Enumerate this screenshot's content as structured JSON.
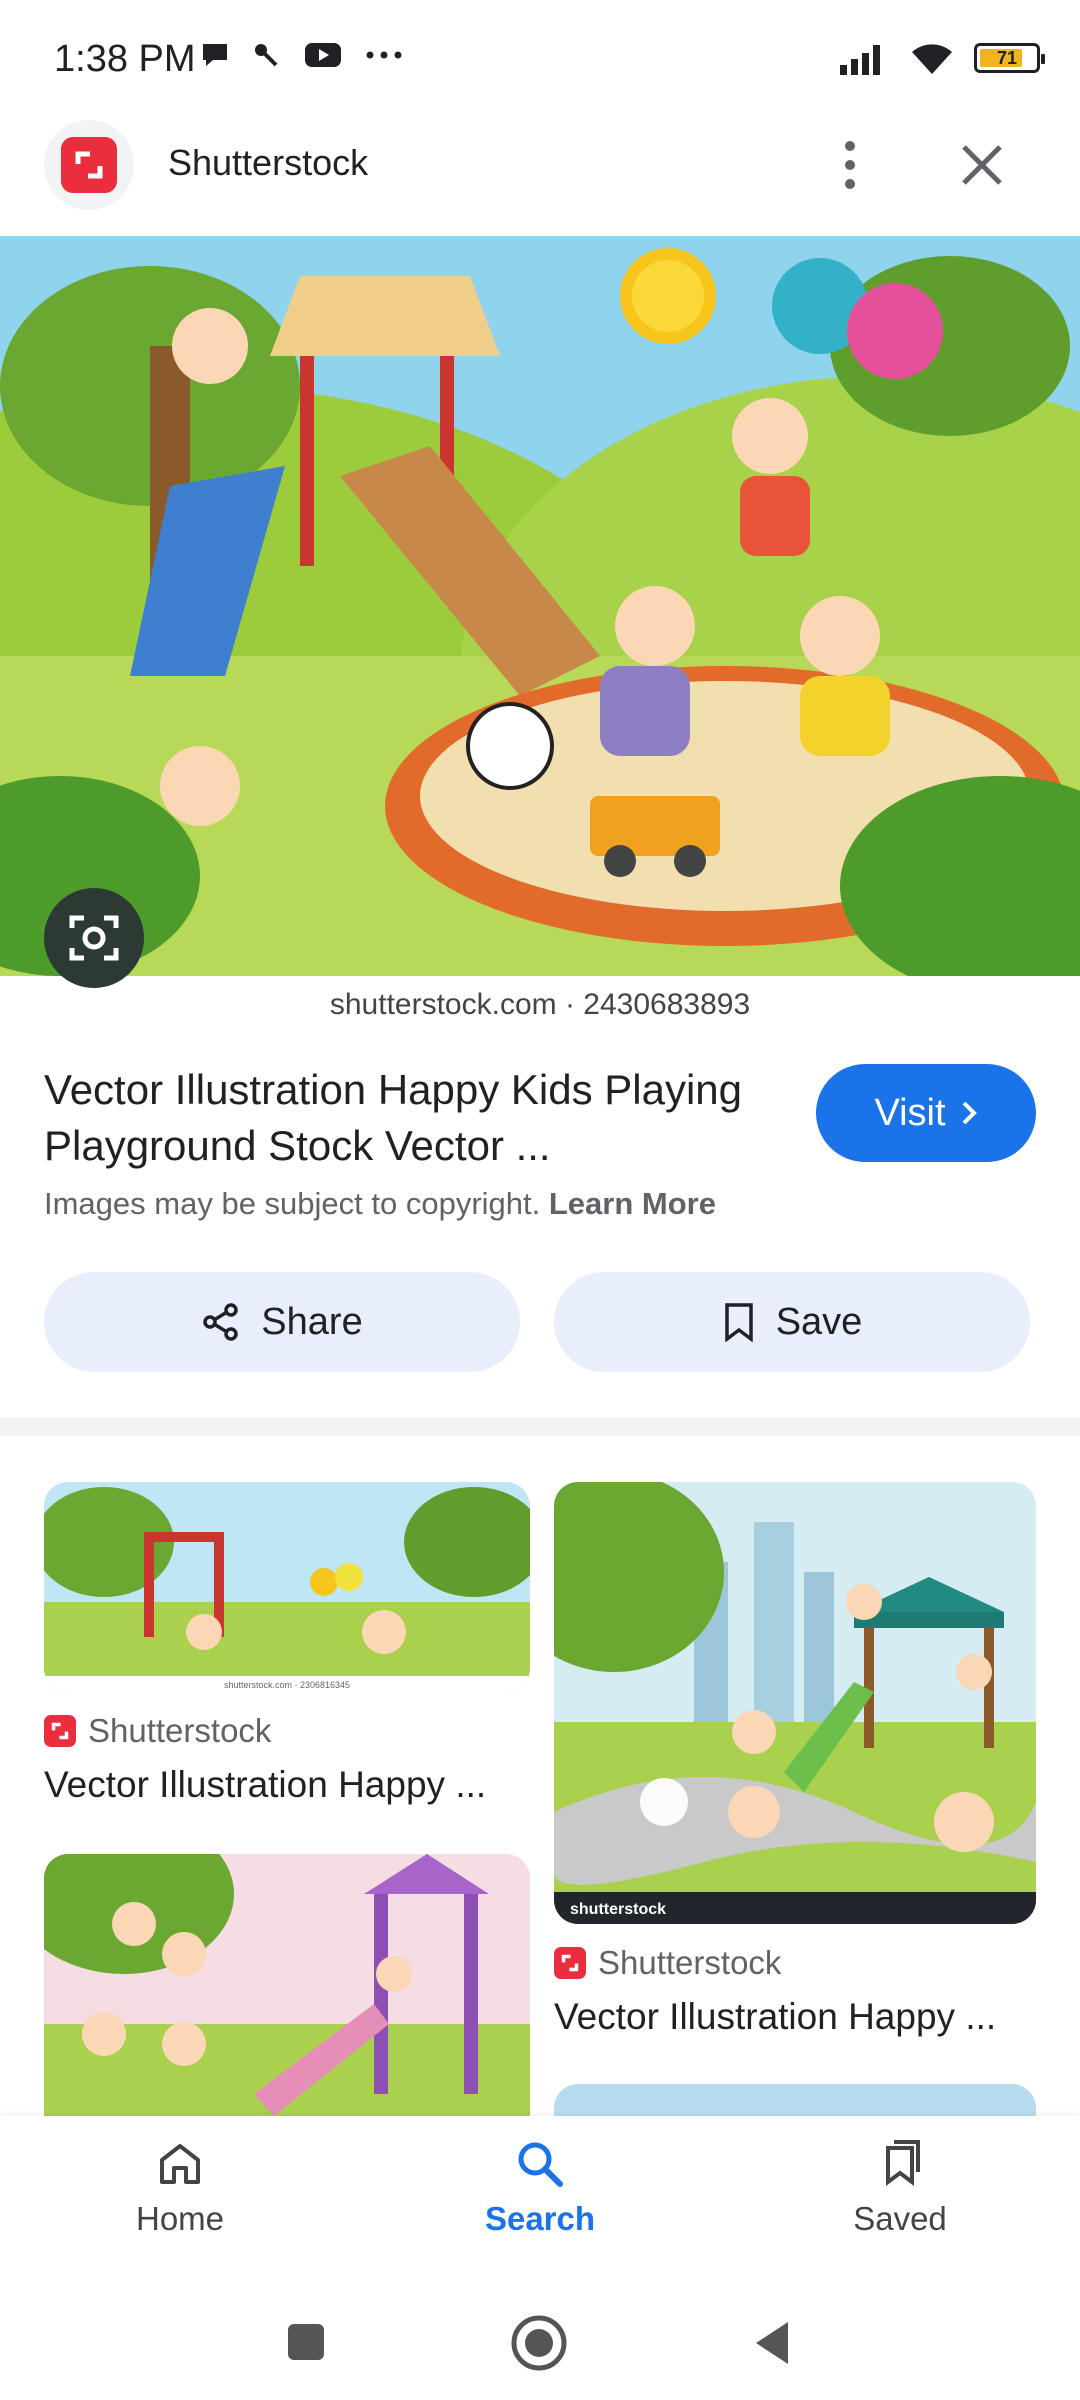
{
  "status_bar": {
    "time": "1:38 PM",
    "battery": "71",
    "icons": [
      "chat-icon",
      "key-icon",
      "youtube-icon",
      "more-dots-icon",
      "signal-icon",
      "wifi-icon",
      "battery-icon"
    ]
  },
  "header": {
    "site_name": "Shutterstock",
    "logo_icon": "shutterstock-logo-icon",
    "more_icon": "more-vert-icon",
    "close_icon": "close-icon"
  },
  "hero": {
    "watermark": "shutterstock.com · 2430683893",
    "lens_icon": "lens-icon"
  },
  "result": {
    "title": "Vector Illustration Happy Kids Playing Playground Stock Vector ...",
    "visit_label": "Visit",
    "copyright_text": "Images may be subject to copyright.",
    "learn_more": "Learn More",
    "share_label": "Share",
    "save_label": "Save"
  },
  "related": [
    {
      "source": "Shutterstock",
      "title": "Vector Illustration Happy ..."
    },
    {
      "source": "Shutterstock",
      "title": "Vector Illustration Happy ..."
    }
  ],
  "related_thumb_texts": {
    "thumb1_watermark": "shutterstock.com · 2306816345",
    "thumb2_brand": "shutterstock"
  },
  "bottom_nav": {
    "items": [
      {
        "label": "Home",
        "icon": "home-icon"
      },
      {
        "label": "Search",
        "icon": "search-icon"
      },
      {
        "label": "Saved",
        "icon": "saved-bookmark-icon"
      }
    ],
    "active": "Search"
  },
  "colors": {
    "accent": "#1a73e8",
    "brand_red": "#ea2e3e",
    "pill_bg": "#e8eefc"
  }
}
